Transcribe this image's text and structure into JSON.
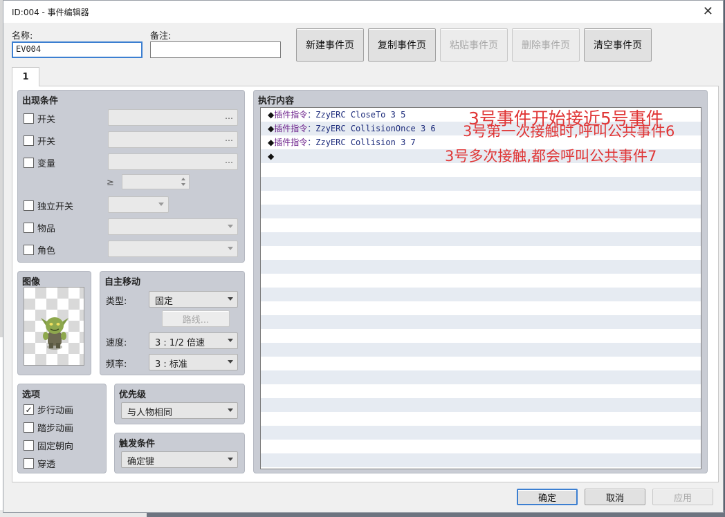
{
  "window": {
    "title": "ID:004 - 事件编辑器",
    "close_glyph": "✕"
  },
  "header": {
    "name_label": "名称:",
    "name_value": "EV004",
    "note_label": "备注:",
    "note_value": ""
  },
  "page_buttons": {
    "new": "新建事件页",
    "copy": "复制事件页",
    "paste": "粘贴事件页",
    "delete": "删除事件页",
    "clear": "清空事件页"
  },
  "tabs": [
    {
      "label": "1"
    }
  ],
  "conditions": {
    "title": "出现条件",
    "switch1": "开关",
    "switch2": "开关",
    "variable": "变量",
    "gte": "≥",
    "self_switch": "独立开关",
    "item": "物品",
    "actor": "角色",
    "dots": "…"
  },
  "image": {
    "title": "图像"
  },
  "autonomous": {
    "title": "自主移动",
    "type_label": "类型:",
    "type_value": "固定",
    "route_button": "路线...",
    "speed_label": "速度:",
    "speed_value": "3 : 1/2 倍速",
    "freq_label": "频率:",
    "freq_value": "3 : 标准"
  },
  "options": {
    "title": "选项",
    "walking": "步行动画",
    "walking_checked": true,
    "stepping": "踏步动画",
    "stepping_checked": false,
    "direction_fix": "固定朝向",
    "direction_fix_checked": false,
    "through": "穿透",
    "through_checked": false
  },
  "priority": {
    "title": "优先级",
    "value": "与人物相同"
  },
  "trigger": {
    "title": "触发条件",
    "value": "确定键"
  },
  "contents": {
    "title": "执行内容",
    "commands": [
      {
        "marker": "◆",
        "keyword": "插件指令",
        "args": "：ZzyERC CloseTo 3 5"
      },
      {
        "marker": "◆",
        "keyword": "插件指令",
        "args": "：ZzyERC CollisionOnce 3 6"
      },
      {
        "marker": "◆",
        "keyword": "插件指令",
        "args": "：ZzyERC Collision 3 7"
      },
      {
        "marker": "◆",
        "keyword": "",
        "args": ""
      }
    ]
  },
  "annotations": {
    "line1": "3号事件开始接近5号事件",
    "line2": "3号第一次接触时,呼叫公共事件6",
    "line3": "3号多次接触,都会呼叫公共事件7",
    "color": "#e03636"
  },
  "footer": {
    "ok": "确定",
    "cancel": "取消",
    "apply": "应用"
  }
}
